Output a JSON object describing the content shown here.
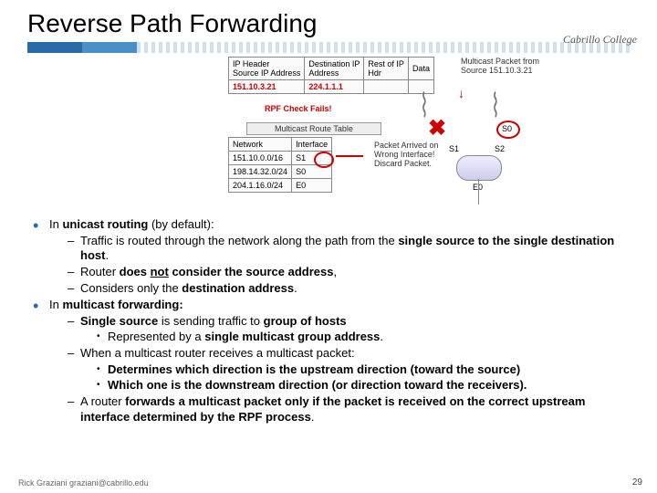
{
  "title": "Reverse Path Forwarding",
  "logo": "Cabrillo College",
  "diagram": {
    "hdr": {
      "c1": "IP Header",
      "c1b": "Source IP Address",
      "c2": "Destination IP",
      "c2b": "Address",
      "c3": "Rest of IP",
      "c3b": "Hdr",
      "c4": "Data"
    },
    "src_ip": "151.10.3.21",
    "dst_ip": "224.1.1.1",
    "rpf_fail": "RPF Check Fails!",
    "mrt_title": "Multicast Route Table",
    "mrt_h1": "Network",
    "mrt_h2": "Interface",
    "r1a": "151.10.0.0/16",
    "r1b": "S1",
    "r2a": "198.14.32.0/24",
    "r2b": "S0",
    "r3a": "204.1.16.0/24",
    "r3b": "E0",
    "side_top": "Multicast Packet from",
    "side_src": "Source 151.10.3.21",
    "arrive1": "Packet Arrived on",
    "arrive2": "Wrong Interface!",
    "arrive3": "Discard Packet.",
    "p_s0": "S0",
    "p_s1": "S1",
    "p_s2": "S2",
    "p_e0": "E0"
  },
  "bul": {
    "unicast_intro_a": "In ",
    "unicast_intro_b": "unicast routing ",
    "unicast_intro_c": "(by default)",
    "u1a": "Traffic is routed through the network along the path from the ",
    "u1b": "single source to the single destination host",
    "u2a": "Router ",
    "u2b": "does ",
    "u2c": "not",
    "u2d": " consider the source address",
    "u3a": "Considers only the ",
    "u3b": "destination address",
    "multicast_intro_a": "In ",
    "multicast_intro_b": "multicast forwarding:",
    "m1a": "Single source ",
    "m1b": "is sending traffic to ",
    "m1c": "group of hosts",
    "m1s1a": "Represented by a ",
    "m1s1b": "single multicast group address",
    "m2": "When a multicast router receives a multicast packet:",
    "m2s1a": "Determines which direction is the upstream direction (toward the source)",
    "m2s2a": "Which one is the downstream direction (or direction toward the receivers).",
    "m3a": "A router ",
    "m3b": "forwards a multicast packet only if the packet is received on the correct upstream interface determined by the RPF process"
  },
  "footer": "Rick Graziani  graziani@cabrillo.edu",
  "page": "29"
}
